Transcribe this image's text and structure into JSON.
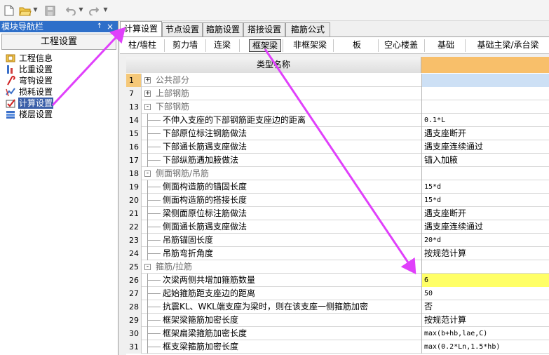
{
  "toolbar": {
    "icons": [
      "new-file-icon",
      "open-folder-icon",
      "save-icon",
      "undo-icon",
      "redo-icon",
      "more-icon"
    ]
  },
  "nav": {
    "title": "模块导航栏",
    "pin_glyph": "↑",
    "close_glyph": "×",
    "header": "工程设置",
    "items": [
      {
        "label": "工程信息",
        "icon": "project-info-icon"
      },
      {
        "label": "比重设置",
        "icon": "weight-settings-icon"
      },
      {
        "label": "弯钩设置",
        "icon": "hook-settings-icon"
      },
      {
        "label": "损耗设置",
        "icon": "loss-settings-icon"
      },
      {
        "label": "计算设置",
        "icon": "calc-settings-icon",
        "selected": true
      },
      {
        "label": "楼层设置",
        "icon": "floor-settings-icon"
      }
    ]
  },
  "tabs": [
    "计算设置",
    "节点设置",
    "箍筋设置",
    "搭接设置",
    "箍筋公式"
  ],
  "subtabs": [
    "柱/墙柱",
    "剪力墙",
    "连梁",
    "框架梁",
    "非框架梁",
    "板",
    "空心楼盖",
    "基础",
    "基础主梁/承台梁"
  ],
  "grid": {
    "header_name": "类型名称",
    "rows": [
      {
        "num": "1",
        "name": "公共部分",
        "type": "group",
        "sign": "+",
        "value": ""
      },
      {
        "num": "7",
        "name": "上部钢筋",
        "type": "group",
        "sign": "+",
        "value": ""
      },
      {
        "num": "13",
        "name": "下部钢筋",
        "type": "group",
        "sign": "-",
        "value": ""
      },
      {
        "num": "14",
        "name": "不伸入支座的下部钢筋距支座边的距离",
        "type": "child",
        "value": "0.1*L"
      },
      {
        "num": "15",
        "name": "下部原位标注钢筋做法",
        "type": "child",
        "value": "遇支座断开"
      },
      {
        "num": "16",
        "name": "下部通长筋遇支座做法",
        "type": "child",
        "value": "遇支座连续通过"
      },
      {
        "num": "17",
        "name": "下部纵筋遇加腋做法",
        "type": "child",
        "value": "锚入加腋"
      },
      {
        "num": "18",
        "name": "侧面钢筋/吊筋",
        "type": "group",
        "sign": "-",
        "value": ""
      },
      {
        "num": "19",
        "name": "侧面构造筋的锚固长度",
        "type": "child",
        "value": "15*d"
      },
      {
        "num": "20",
        "name": "侧面构造筋的搭接长度",
        "type": "child",
        "value": "15*d"
      },
      {
        "num": "21",
        "name": "梁侧面原位标注筋做法",
        "type": "child",
        "value": "遇支座断开"
      },
      {
        "num": "22",
        "name": "侧面通长筋遇支座做法",
        "type": "child",
        "value": "遇支座连续通过"
      },
      {
        "num": "23",
        "name": "吊筋锚固长度",
        "type": "child",
        "value": "20*d"
      },
      {
        "num": "24",
        "name": "吊筋弯折角度",
        "type": "child",
        "value": "按规范计算"
      },
      {
        "num": "25",
        "name": "箍筋/拉筋",
        "type": "group",
        "sign": "-",
        "value": ""
      },
      {
        "num": "26",
        "name": "次梁两侧共增加箍筋数量",
        "type": "child",
        "value": "6",
        "highlight": true
      },
      {
        "num": "27",
        "name": "起始箍筋距支座边的距离",
        "type": "child",
        "value": "50"
      },
      {
        "num": "28",
        "name": "抗震KL、WKL端支座为梁时，则在该支座一侧箍筋加密",
        "type": "child",
        "value": "否"
      },
      {
        "num": "29",
        "name": "框架梁箍筋加密长度",
        "type": "child",
        "value": "按规范计算"
      },
      {
        "num": "30",
        "name": "框架扁梁箍筋加密长度",
        "type": "child",
        "value": "max(b+hb,lae,C)"
      },
      {
        "num": "31",
        "name": "框支梁箍筋加密长度",
        "type": "child",
        "value": "max(0.2*Ln,1.5*hb)"
      }
    ]
  },
  "colors": {
    "highlight": "#ffff66",
    "header_value": "#f8bf6a",
    "arrow": "#e040fb",
    "nav_title": "#2e6fc9"
  }
}
